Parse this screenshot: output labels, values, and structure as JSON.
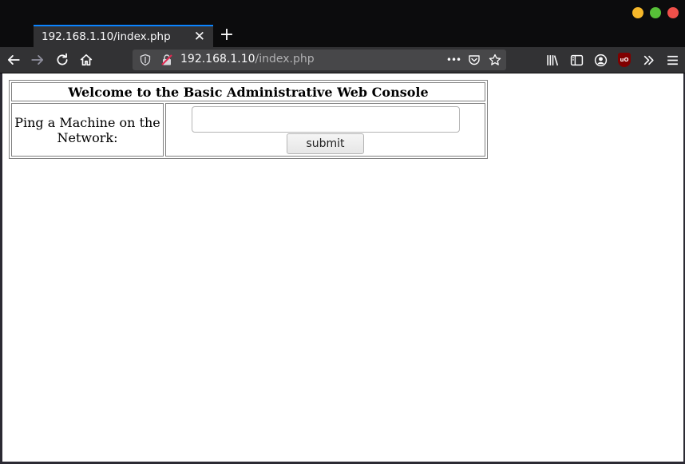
{
  "browser": {
    "tab": {
      "title": "192.168.1.10/index.php",
      "close_glyph": "✕"
    },
    "new_tab_glyph": "+",
    "url": {
      "host": "192.168.1.10",
      "path": "/index.php"
    },
    "url_actions_glyph": "•••",
    "ublock_label": "uO",
    "window_control_colors": {
      "minimize": "#f6b82a",
      "maximize": "#57c038",
      "close": "#f0504a"
    },
    "accent": "#0a84ff"
  },
  "page": {
    "heading": "Welcome to the Basic Administrative Web Console",
    "ping_label": "Ping a Machine on the Network:",
    "ping_input": {
      "value": "",
      "placeholder": ""
    },
    "submit_label": "submit"
  }
}
